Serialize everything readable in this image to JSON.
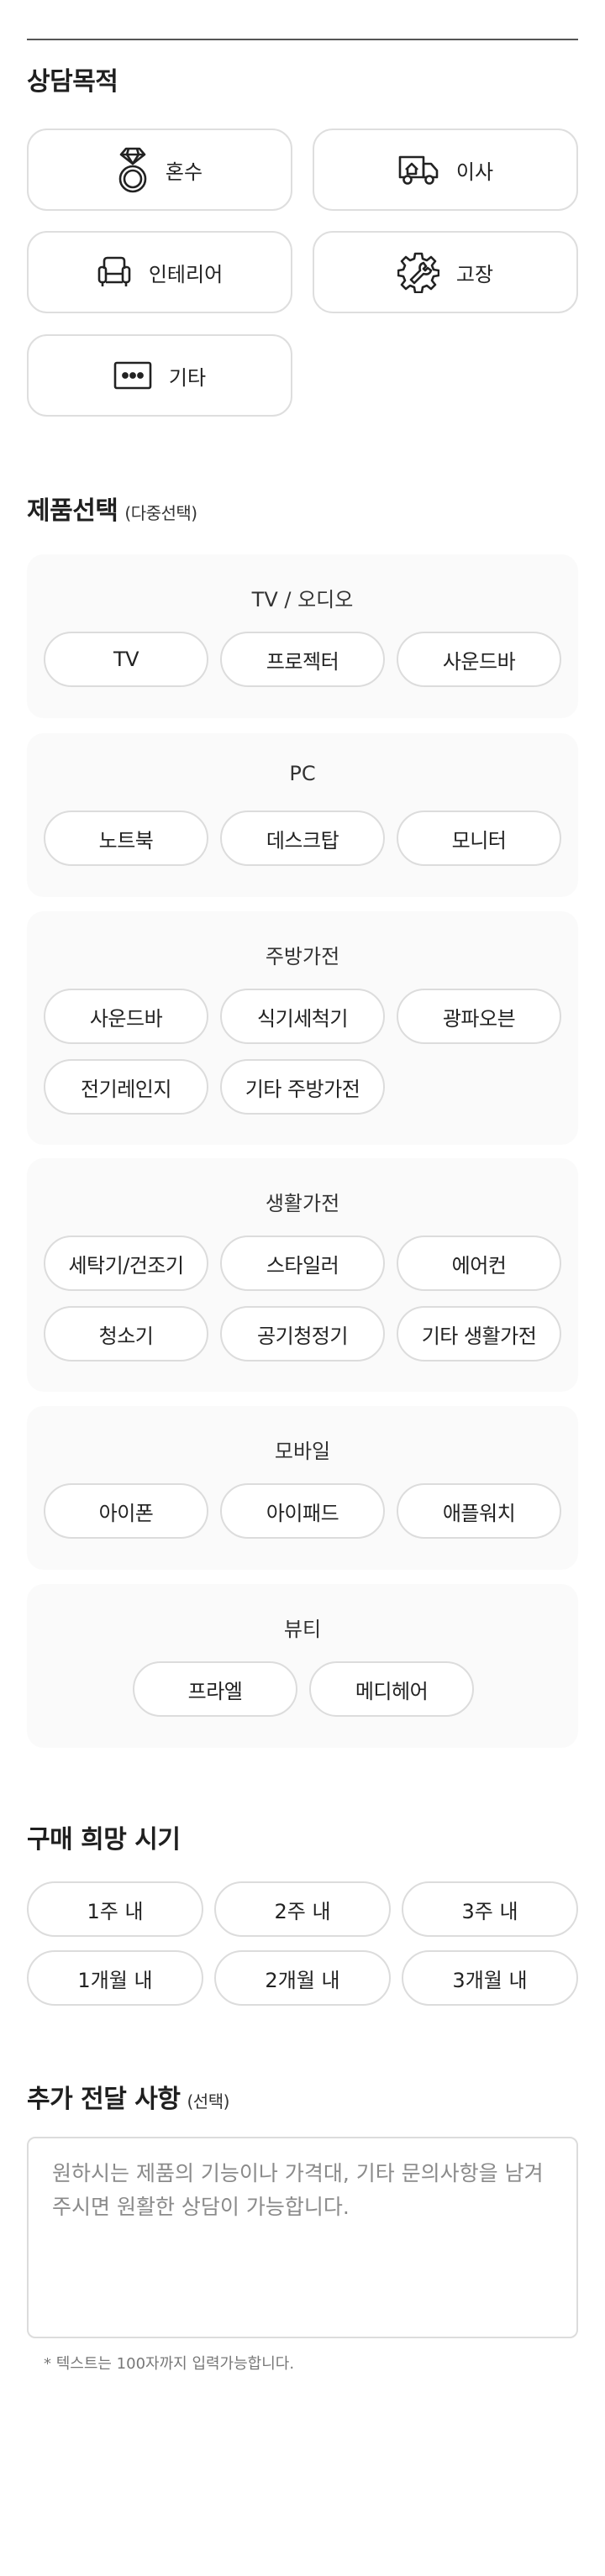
{
  "purpose": {
    "title": "상담목적",
    "items": [
      {
        "label": "혼수",
        "icon": "ring-icon"
      },
      {
        "label": "이사",
        "icon": "moving-truck-icon"
      },
      {
        "label": "인테리어",
        "icon": "armchair-icon"
      },
      {
        "label": "고장",
        "icon": "gear-wrench-icon"
      },
      {
        "label": "기타",
        "icon": "more-dots-icon"
      }
    ]
  },
  "products": {
    "title": "제품선택",
    "subtitle": "(다중선택)",
    "groups": [
      {
        "title": "TV / 오디오",
        "items": [
          "TV",
          "프로젝터",
          "사운드바"
        ]
      },
      {
        "title": "PC",
        "items": [
          "노트북",
          "데스크탑",
          "모니터"
        ]
      },
      {
        "title": "주방가전",
        "items": [
          "사운드바",
          "식기세척기",
          "광파오븐",
          "전기레인지",
          "기타 주방가전"
        ]
      },
      {
        "title": "생활가전",
        "items": [
          "세탁기/건조기",
          "스타일러",
          "에어컨",
          "청소기",
          "공기청정기",
          "기타 생활가전"
        ]
      },
      {
        "title": "모바일",
        "items": [
          "아이폰",
          "아이패드",
          "애플워치"
        ]
      },
      {
        "title": "뷰티",
        "items": [
          "프라엘",
          "메디헤어"
        ]
      }
    ]
  },
  "timing": {
    "title": "구매 희망 시기",
    "items": [
      "1주 내",
      "2주 내",
      "3주 내",
      "1개월 내",
      "2개월 내",
      "3개월 내"
    ]
  },
  "memo": {
    "title": "추가 전달 사항",
    "subtitle": "(선택)",
    "placeholder": "원하시는 제품의 기능이나 가격대, 기타 문의사항을 남겨주시면 원활한 상담이 가능합니다.",
    "note": "* 텍스트는 100자까지 입력가능합니다."
  }
}
